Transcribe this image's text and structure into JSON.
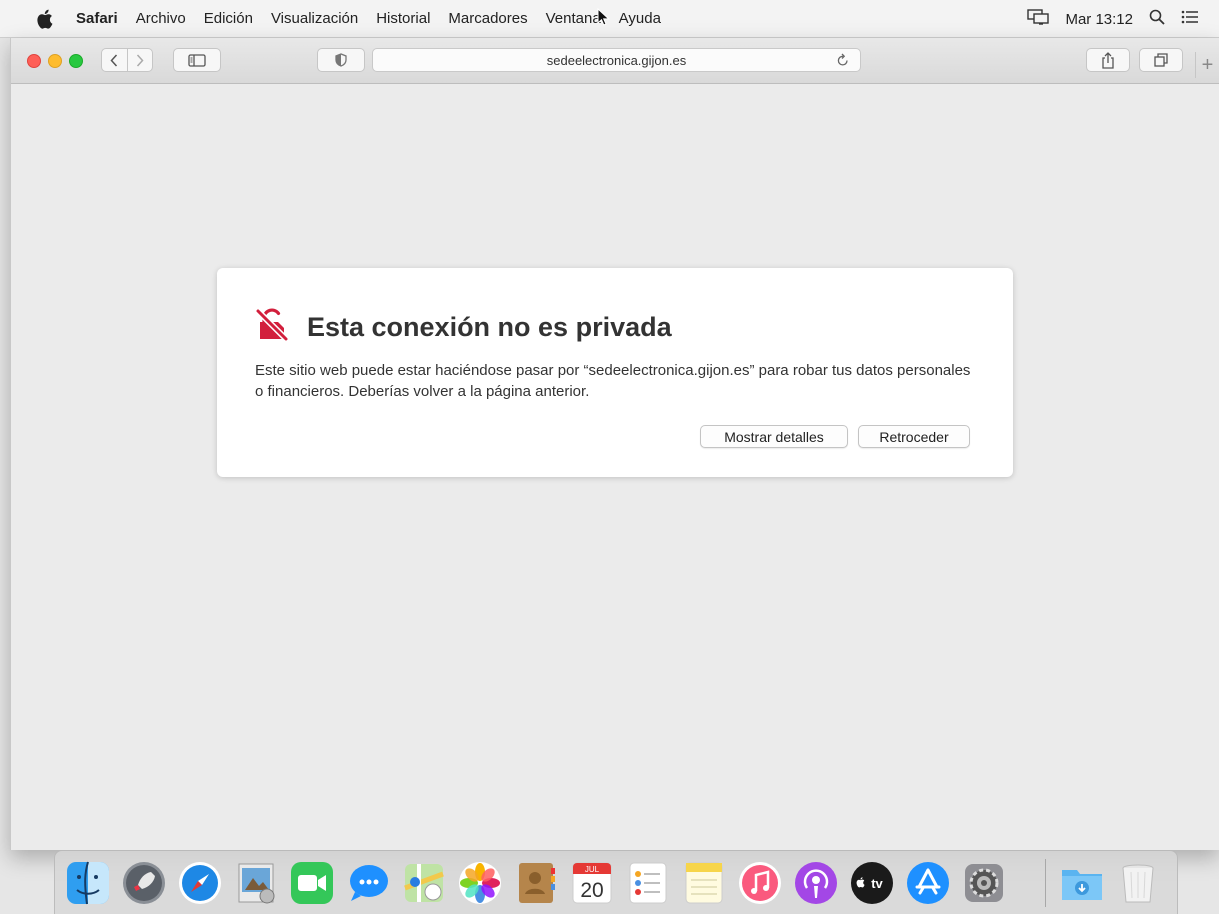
{
  "menubar": {
    "items": [
      "Safari",
      "Archivo",
      "Edición",
      "Visualización",
      "Historial",
      "Marcadores",
      "Ventana",
      "Ayuda"
    ],
    "clock": "Mar 13:12"
  },
  "toolbar": {
    "address": "sedeelectronica.gijon.es",
    "new_tab": "+"
  },
  "error": {
    "title": "Esta conexión no es privada",
    "body": "Este sitio web puede estar haciéndose pasar por “sedeelectronica.gijon.es” para robar tus datos personales o financieros. Deberías volver a la página anterior.",
    "details_button": "Mostrar detalles",
    "back_button": "Retroceder"
  },
  "dock": {
    "calendar_month": "JUL",
    "calendar_day": "20",
    "tv_label": "tv",
    "apps": [
      "finder",
      "launchpad",
      "safari",
      "preview",
      "facetime",
      "messages",
      "maps",
      "photos",
      "contacts",
      "calendar",
      "reminders",
      "notes",
      "music",
      "podcasts",
      "tv",
      "app-store",
      "system-preferences",
      "downloads",
      "trash"
    ]
  }
}
